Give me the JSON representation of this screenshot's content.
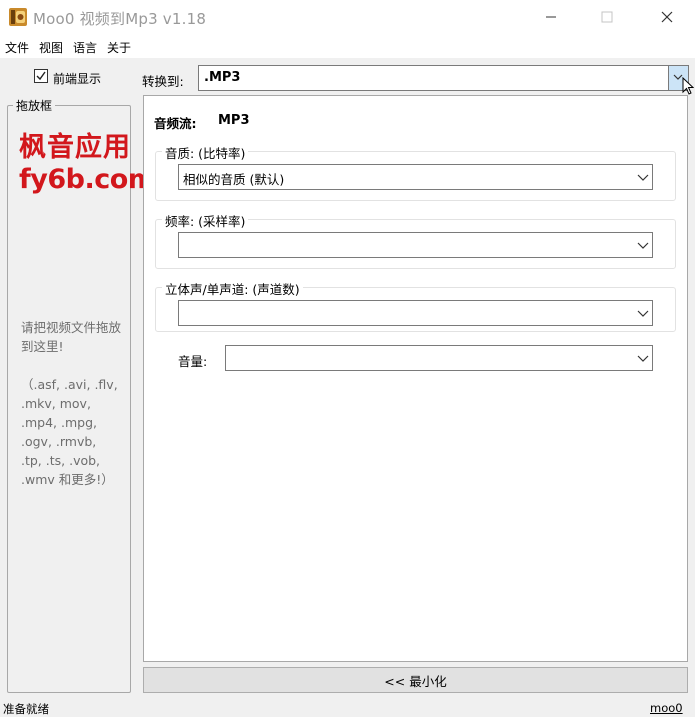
{
  "window": {
    "title": "Moo0 视频到Mp3 v1.18",
    "icon": "app-logo-icon",
    "controls": [
      "minimize-icon",
      "maximize-icon",
      "close-icon"
    ]
  },
  "menu": {
    "items": [
      "文件",
      "视图",
      "语言",
      "关于"
    ]
  },
  "left_panel": {
    "foreground_label": "前端显示",
    "foreground_checked": true,
    "drop_frame_title": "拖放框",
    "watermark_line1": "枫音应用",
    "watermark_line2": "fy6b.com",
    "hint": "请把视频文件拖放到这里!",
    "extensions": "（.asf, .avi, .flv, .mkv, mov, .mp4, .mpg, .ogv, .rmvb, .tp, .ts, .vob, .wmv 和更多!）"
  },
  "convert": {
    "label": "转换到:",
    "format": ".MP3"
  },
  "panel": {
    "audio_stream_label": "音频流:",
    "audio_stream_value": "MP3",
    "quality_label": "音质:  (比特率)",
    "quality_value": "相似的音质  (默认)",
    "frequency_label": "频率:  (采样率)",
    "frequency_value": "",
    "channels_label": "立体声/单声道:   (声道数)",
    "channels_value": "",
    "volume_label": "音量:",
    "volume_value": ""
  },
  "minimize_button": "<< 最小化",
  "status": {
    "text": "准备就绪",
    "link": "moo0"
  },
  "colors": {
    "watermark": "#d2171c",
    "selected_arrow_bg": "#cce4f7",
    "window_bg": "#f0f0f0"
  }
}
